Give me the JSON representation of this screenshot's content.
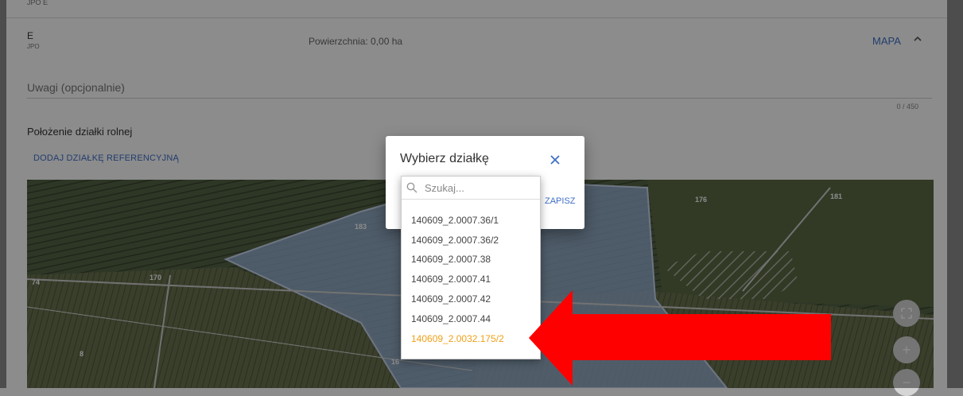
{
  "header": {
    "previous_row_label": "JPO E",
    "row": {
      "letter": "E",
      "sub": "JPO",
      "area": "Powierzchnia: 0,00 ha",
      "map_label": "MAPA",
      "collapse_icon": "chevron-up-icon"
    }
  },
  "notes": {
    "placeholder": "Uwagi (opcjonalnie)",
    "counter": "0 / 450"
  },
  "location": {
    "title": "Położenie działki rolnej",
    "add_reference_label": "DODAJ DZIAŁKĘ REFERENCYJNĄ"
  },
  "map": {
    "parcel_labels": [
      "183",
      "176",
      "181",
      "74",
      "170",
      "16",
      "8"
    ],
    "controls": [
      "fullscreen-icon",
      "zoom-in-icon",
      "zoom-out-icon"
    ]
  },
  "dialog": {
    "title": "Wybierz działkę",
    "close_icon": "close-icon",
    "save_label": "ZAPISZ",
    "search": {
      "placeholder": "Szukaj...",
      "value": ""
    },
    "options": [
      "140609_2.0007.36/1",
      "140609_2.0007.36/2",
      "140609_2.0007.38",
      "140609_2.0007.41",
      "140609_2.0007.42",
      "140609_2.0007.44",
      "140609_2.0032.175/2"
    ],
    "selected_option": "140609_2.0032.175/2"
  },
  "colors": {
    "accent": "#3f6fc8",
    "selected": "#f0a018",
    "arrow": "#ff0000"
  }
}
